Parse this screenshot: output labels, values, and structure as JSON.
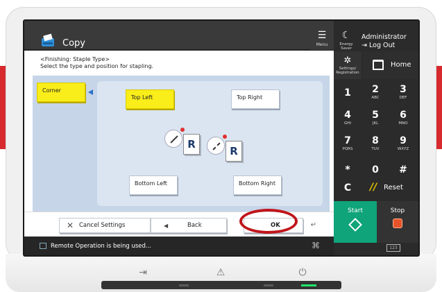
{
  "app": {
    "title": "Copy"
  },
  "header": {
    "menu_label": "Menu",
    "energy_label": "Energy Saver",
    "user": "Administrator",
    "logout_label": "Log Out"
  },
  "nav": {
    "settings_label": "Settings/ Registration",
    "home_label": "Home"
  },
  "instruction": {
    "line1": "<Finishing: Staple Type>",
    "line2": "Select the type and position for stapling."
  },
  "staple": {
    "corner_label": "Corner",
    "top_left": "Top Left",
    "top_right": "Top Right",
    "bottom_left": "Bottom Left",
    "bottom_right": "Bottom Right",
    "doc_letter": "R"
  },
  "actions": {
    "cancel_label": "Cancel Settings",
    "back_label": "Back",
    "ok_label": "OK"
  },
  "status": {
    "text": "Remote Operation is being used..."
  },
  "keypad": [
    {
      "n": "1",
      "s": ""
    },
    {
      "n": "2",
      "s": "ABC"
    },
    {
      "n": "3",
      "s": "DEF"
    },
    {
      "n": "4",
      "s": "GHI"
    },
    {
      "n": "5",
      "s": "JKL"
    },
    {
      "n": "6",
      "s": "MNO"
    },
    {
      "n": "7",
      "s": "PQRS"
    },
    {
      "n": "8",
      "s": "TUV"
    },
    {
      "n": "9",
      "s": "WXYZ"
    },
    {
      "n": "*",
      "s": ""
    },
    {
      "n": "0",
      "s": ""
    },
    {
      "n": "#",
      "s": ""
    }
  ],
  "controls": {
    "clear_label": "C",
    "reset_label": "Reset",
    "start_label": "Start",
    "stop_label": "Stop",
    "counter_label": "123"
  },
  "colors": {
    "selected": "#f9ed1a",
    "start": "#0fa47a",
    "stop_icon": "#e8542a",
    "highlight_ring": "#c0151b",
    "brand_red": "#d62a2f"
  }
}
